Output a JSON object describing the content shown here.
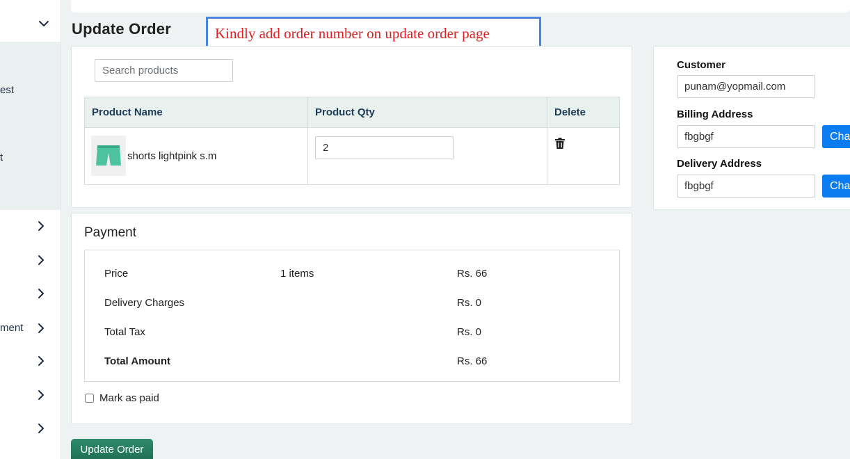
{
  "sidebar": {
    "items": [
      {
        "label": "",
        "icon": "chevron-down-icon"
      },
      {
        "label": "est"
      },
      {
        "label": "t"
      },
      {
        "label": "",
        "icon": "chevron-right-icon"
      },
      {
        "label": "",
        "icon": "chevron-right-icon"
      },
      {
        "label": "",
        "icon": "chevron-right-icon"
      },
      {
        "label": "ment",
        "icon": "chevron-right-icon"
      },
      {
        "label": "",
        "icon": "chevron-right-icon"
      },
      {
        "label": "",
        "icon": "chevron-right-icon"
      },
      {
        "label": "",
        "icon": "chevron-right-icon"
      }
    ]
  },
  "page": {
    "title": "Update Order",
    "annotation": "Kindly add order number on update order page"
  },
  "products": {
    "search_placeholder": "Search products",
    "columns": [
      "Product Name",
      "Product Qty",
      "Delete"
    ],
    "rows": [
      {
        "name": "shorts lightpink s.m",
        "qty": "2",
        "thumb_icon": "shorts-icon",
        "delete_icon": "trash-icon"
      }
    ]
  },
  "payment": {
    "title": "Payment",
    "rows": [
      {
        "label": "Price",
        "detail": "1 items",
        "amount": "Rs. 66"
      },
      {
        "label": "Delivery Charges",
        "detail": "",
        "amount": "Rs. 0"
      },
      {
        "label": "Total Tax",
        "detail": "",
        "amount": "Rs. 0"
      },
      {
        "label": "Total Amount",
        "detail": "",
        "amount": "Rs. 66"
      }
    ],
    "mark_paid_label": "Mark as paid",
    "mark_paid_checked": false
  },
  "customer": {
    "customer_label": "Customer",
    "customer_value": "punam@yopmail.com",
    "billing_label": "Billing Address",
    "billing_value": "fbgbgf",
    "delivery_label": "Delivery Address",
    "delivery_value": "fbgbgf",
    "change_label": "Change"
  },
  "actions": {
    "update_label": "Update Order"
  },
  "colors": {
    "accent_green": "#2f8a6a",
    "change_blue": "#0b7cf0",
    "annotation_red": "#e02020",
    "annotation_border": "#4a86e0"
  }
}
